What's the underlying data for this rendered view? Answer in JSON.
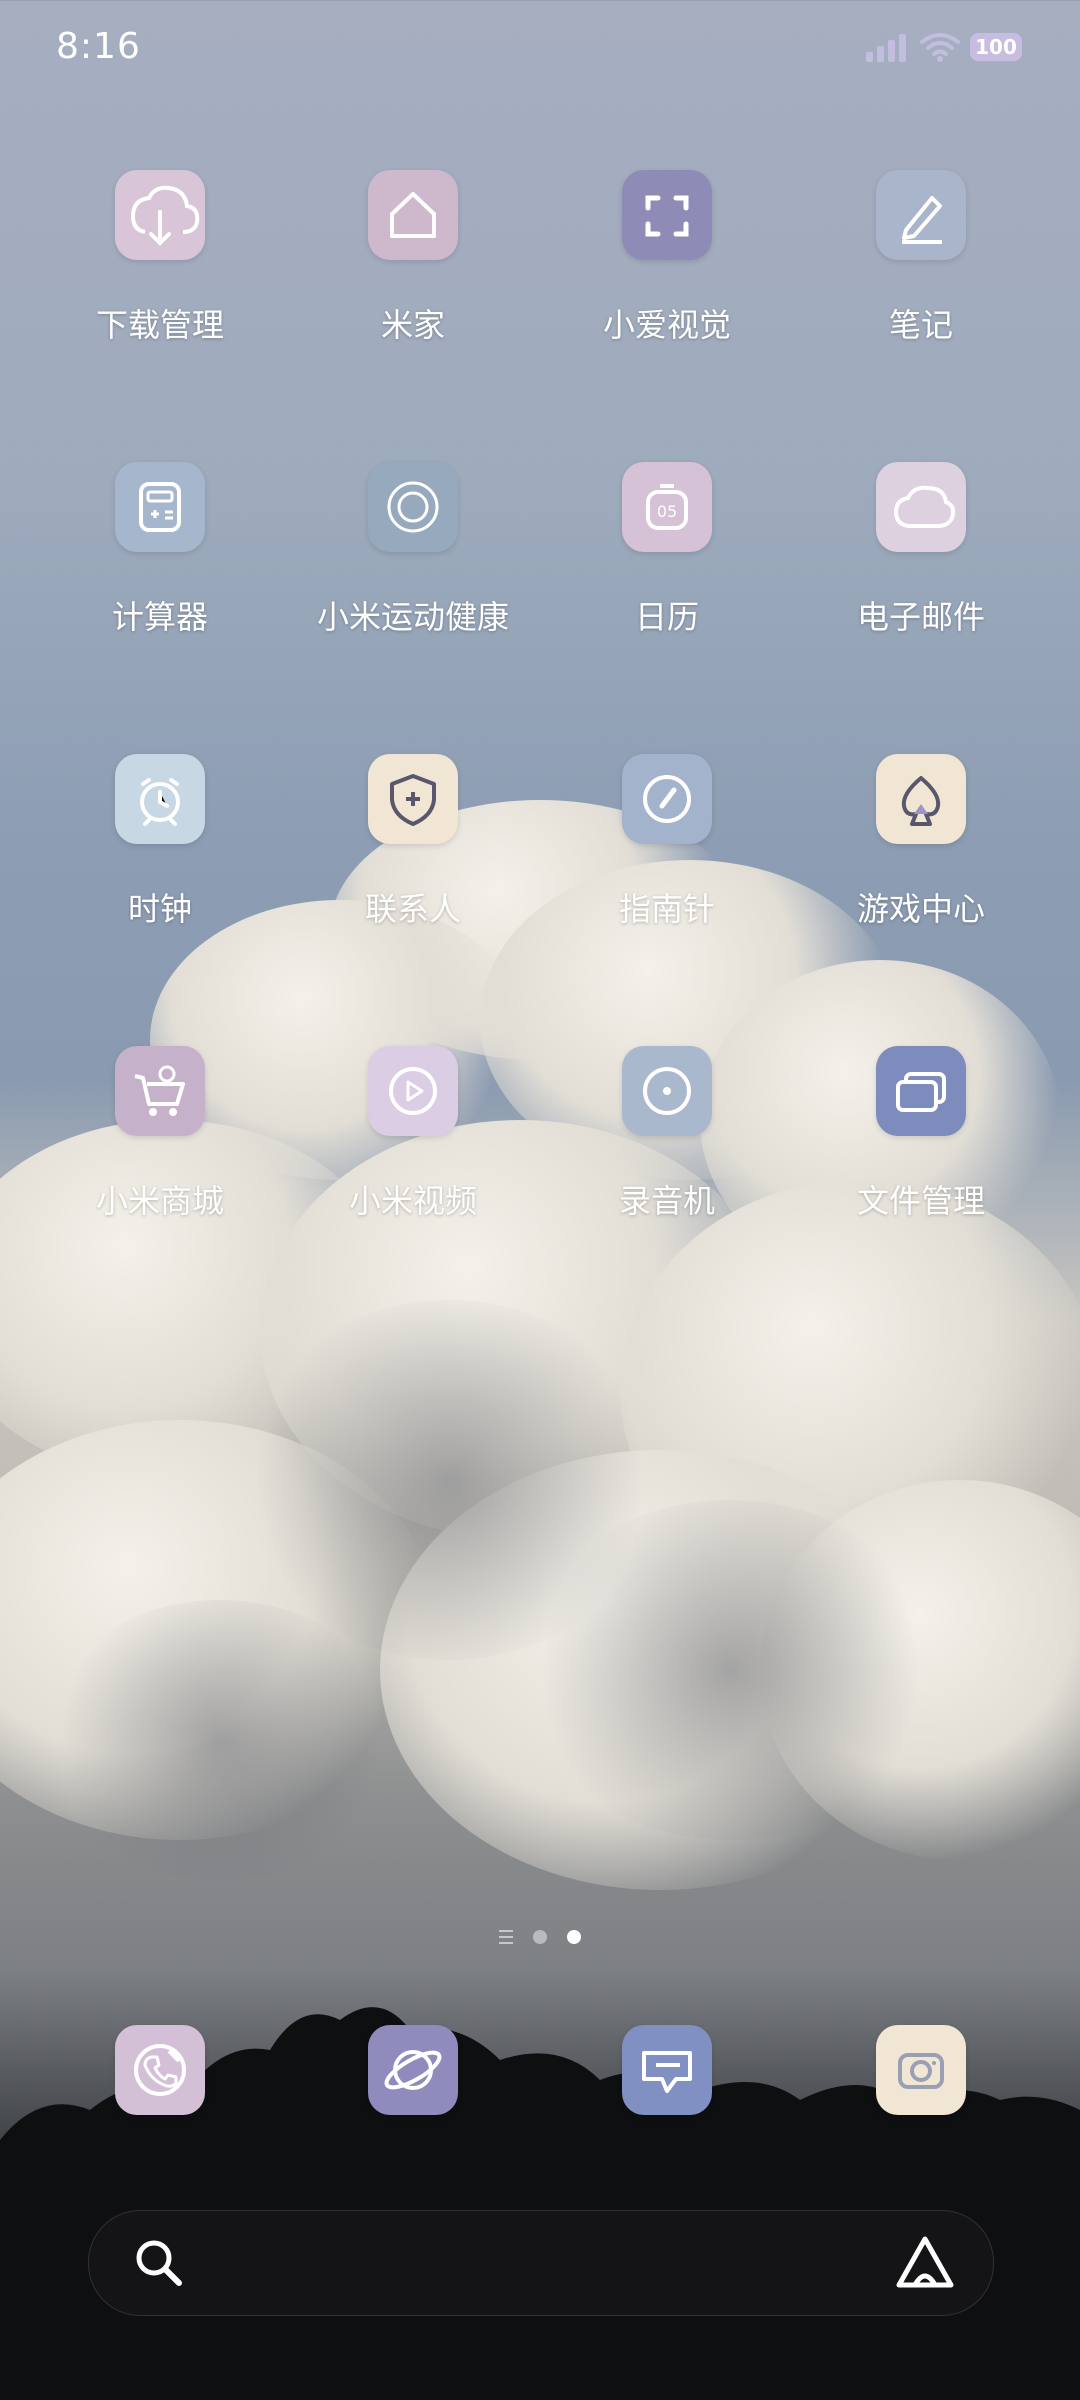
{
  "status_bar": {
    "time": "8:16",
    "battery": "100"
  },
  "apps": [
    {
      "label": "下载管理",
      "icon": "download-icon",
      "color": "#d8c6d8"
    },
    {
      "label": "米家",
      "icon": "home-icon",
      "color": "#cdb8cc"
    },
    {
      "label": "小爱视觉",
      "icon": "scan-icon",
      "color": "#8e8bb6"
    },
    {
      "label": "笔记",
      "icon": "pen-icon",
      "color": "#a9b5cb"
    },
    {
      "label": "计算器",
      "icon": "calculator-icon",
      "color": "#a5b6cd"
    },
    {
      "label": "小米运动健康",
      "icon": "rings-icon",
      "color": "#97a9bd"
    },
    {
      "label": "日历",
      "icon": "calendar-icon",
      "color": "#d6c2d6"
    },
    {
      "label": "电子邮件",
      "icon": "mail-cloud-icon",
      "color": "#ddd0df"
    },
    {
      "label": "时钟",
      "icon": "alarm-clock-icon",
      "color": "#c7d8e4"
    },
    {
      "label": "联系人",
      "icon": "shield-plus-icon",
      "color": "#f1e6d4"
    },
    {
      "label": "指南针",
      "icon": "compass-icon",
      "color": "#a2b3cb"
    },
    {
      "label": "游戏中心",
      "icon": "spade-icon",
      "color": "#f1e6d4"
    },
    {
      "label": "小米商城",
      "icon": "cart-icon",
      "color": "#c6b1cb"
    },
    {
      "label": "小米视频",
      "icon": "play-icon",
      "color": "#dbcde3"
    },
    {
      "label": "录音机",
      "icon": "record-icon",
      "color": "#a9b8cd"
    },
    {
      "label": "文件管理",
      "icon": "folder-icon",
      "color": "#7d8bbd"
    }
  ],
  "pages": {
    "count": 2,
    "current": 2
  },
  "dock": [
    {
      "name": "phone",
      "icon": "phone-icon",
      "color": "#d3c0d6"
    },
    {
      "name": "browser",
      "icon": "planet-icon",
      "color": "#8f8bbd"
    },
    {
      "name": "messages",
      "icon": "message-icon",
      "color": "#8090c2"
    },
    {
      "name": "camera",
      "icon": "camera-icon",
      "color": "#f1e6d4"
    }
  ],
  "search_bar": {
    "search_icon": "search-icon",
    "assistant_icon": "assistant-icon"
  }
}
